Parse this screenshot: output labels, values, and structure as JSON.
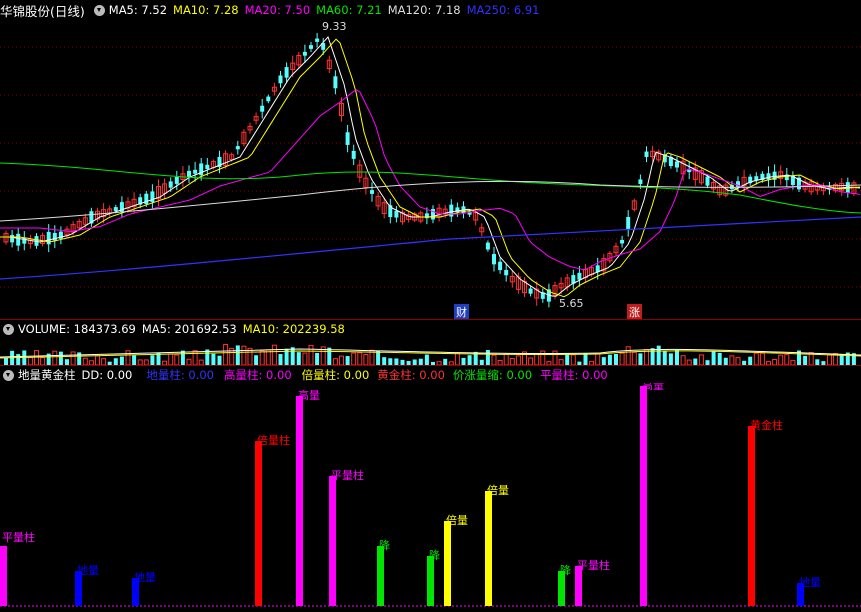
{
  "header_main": {
    "title": "华锦股份(日线)",
    "ma5": "MA5: 7.52",
    "ma10": "MA10: 7.28",
    "ma20": "MA20: 7.50",
    "ma60": "MA60: 7.21",
    "ma120": "MA120: 7.18",
    "ma250": "MA250: 6.91"
  },
  "colors": {
    "up": "#ff3232",
    "down": "#54ffff",
    "ma5": "#ffffff",
    "ma10": "#ffff00",
    "ma20": "#ff00ff",
    "ma60": "#00e600",
    "ma120": "#dddddd",
    "ma250": "#3232ff",
    "grid": "#8b0000"
  },
  "price_annotations": {
    "high": "9.33",
    "low": "5.65",
    "badge_cai": "财",
    "badge_zhang": "涨"
  },
  "header_volume": {
    "volume": "VOLUME: 184373.69",
    "ma5": "MA5: 201692.53",
    "ma10": "MA10: 202239.58"
  },
  "header_indicator": {
    "name": "地量黄金柱",
    "dd": "DD: 0.00",
    "diliang": "地量柱: 0.00",
    "gaoliang": "高量柱: 0.00",
    "beiliang": "倍量柱: 0.00",
    "huangjin": "黄金柱: 0.00",
    "jiazhang": "价涨量缩: 0.00",
    "pingliang": "平量柱: 0.00"
  },
  "chart_data": {
    "type": "bar",
    "title": "地量黄金柱",
    "bars": [
      {
        "label": "平量柱",
        "color": "#ff00ff"
      },
      {
        "label": "地量",
        "color": "#0000ff"
      },
      {
        "label": "地量",
        "color": "#0000ff"
      },
      {
        "label": "倍量柱",
        "color": "#ff0000"
      },
      {
        "label": "高量",
        "color": "#ff00ff"
      },
      {
        "label": "平量柱",
        "color": "#ff00ff"
      },
      {
        "label": "降",
        "color": "#00e600"
      },
      {
        "label": "降",
        "color": "#00e600"
      },
      {
        "label": "倍量",
        "color": "#ffff00"
      },
      {
        "label": "倍量",
        "color": "#ffff00"
      },
      {
        "label": "降",
        "color": "#00e600"
      },
      {
        "label": "平量柱",
        "color": "#ff00ff"
      },
      {
        "label": "高量",
        "color": "#ff00ff"
      },
      {
        "label": "黄金柱",
        "color": "#ff0000"
      },
      {
        "label": "地量",
        "color": "#0000ff"
      }
    ]
  }
}
